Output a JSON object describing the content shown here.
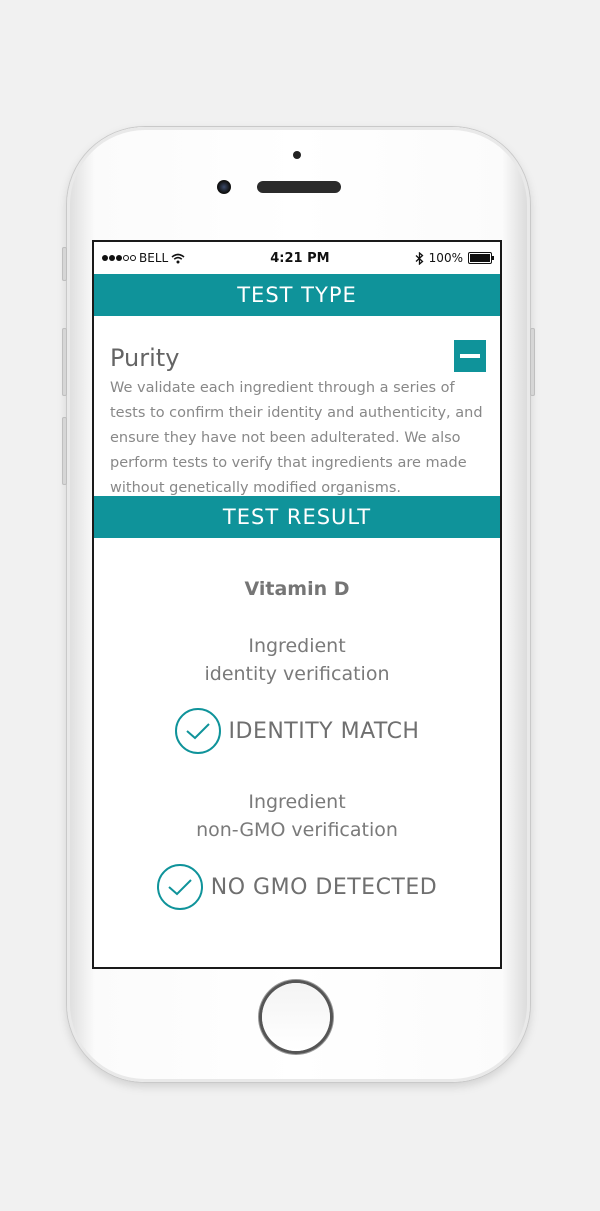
{
  "status_bar": {
    "carrier": "BELL",
    "time": "4:21 PM",
    "battery": "100%",
    "battery_level": 1.0
  },
  "test_type": {
    "header": "TEST TYPE",
    "title": "Purity",
    "description": "We validate each ingredient through a series of tests to confirm their identity and authenticity, and ensure they have not been adulterated. We also perform tests to verify that ingredients are made without genetically modified organisms."
  },
  "test_result": {
    "header": "TEST RESULT",
    "ingredient": "Vitamin D",
    "checks": [
      {
        "label_line1": "Ingredient",
        "label_line2": "identity verification",
        "result": "IDENTITY MATCH"
      },
      {
        "label_line1": "Ingredient",
        "label_line2": "non-GMO verification",
        "result": "NO GMO DETECTED"
      }
    ]
  },
  "colors": {
    "accent": "#0f939a",
    "text_gray": "#6f6f6f"
  },
  "icons": {
    "collapse": "minus-icon",
    "check": "check-circle-icon",
    "wifi": "wifi-icon",
    "bluetooth": "bluetooth-icon"
  }
}
